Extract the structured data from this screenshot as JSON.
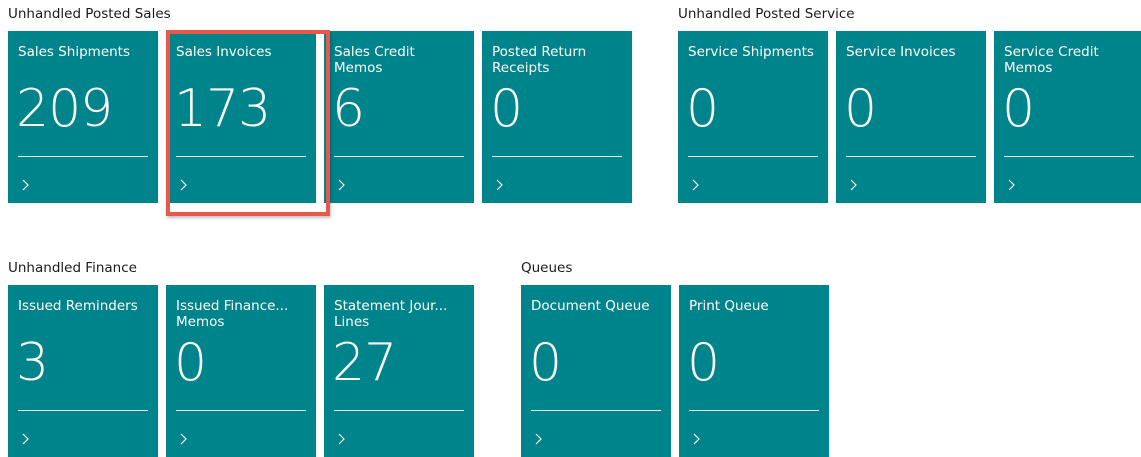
{
  "groups": [
    {
      "title": "Unhandled Posted Sales",
      "tiles": [
        {
          "label": "Sales Shipments",
          "value": "209"
        },
        {
          "label": "Sales Invoices",
          "value": "173"
        },
        {
          "label": "Sales Credit Memos",
          "value": "6"
        },
        {
          "label": "Posted Return Receipts",
          "value": "0"
        }
      ]
    },
    {
      "title": "Unhandled Posted Service",
      "tiles": [
        {
          "label": "Service Shipments",
          "value": "0"
        },
        {
          "label": "Service Invoices",
          "value": "0"
        },
        {
          "label": "Service Credit Memos",
          "value": "0"
        }
      ]
    },
    {
      "title": "Unhandled Finance",
      "tiles": [
        {
          "label": "Issued Reminders",
          "value": "3"
        },
        {
          "label": "Issued Finance... Memos",
          "value": "0"
        },
        {
          "label": "Statement Jour... Lines",
          "value": "27"
        }
      ]
    },
    {
      "title": "Queues",
      "tiles": [
        {
          "label": "Document Queue",
          "value": "0"
        },
        {
          "label": "Print Queue",
          "value": "0"
        }
      ]
    }
  ],
  "colors": {
    "tile_background": "#00848b",
    "highlight_border": "#e8584a"
  },
  "icons": {
    "tile_drilldown": "chevron-right-icon"
  }
}
